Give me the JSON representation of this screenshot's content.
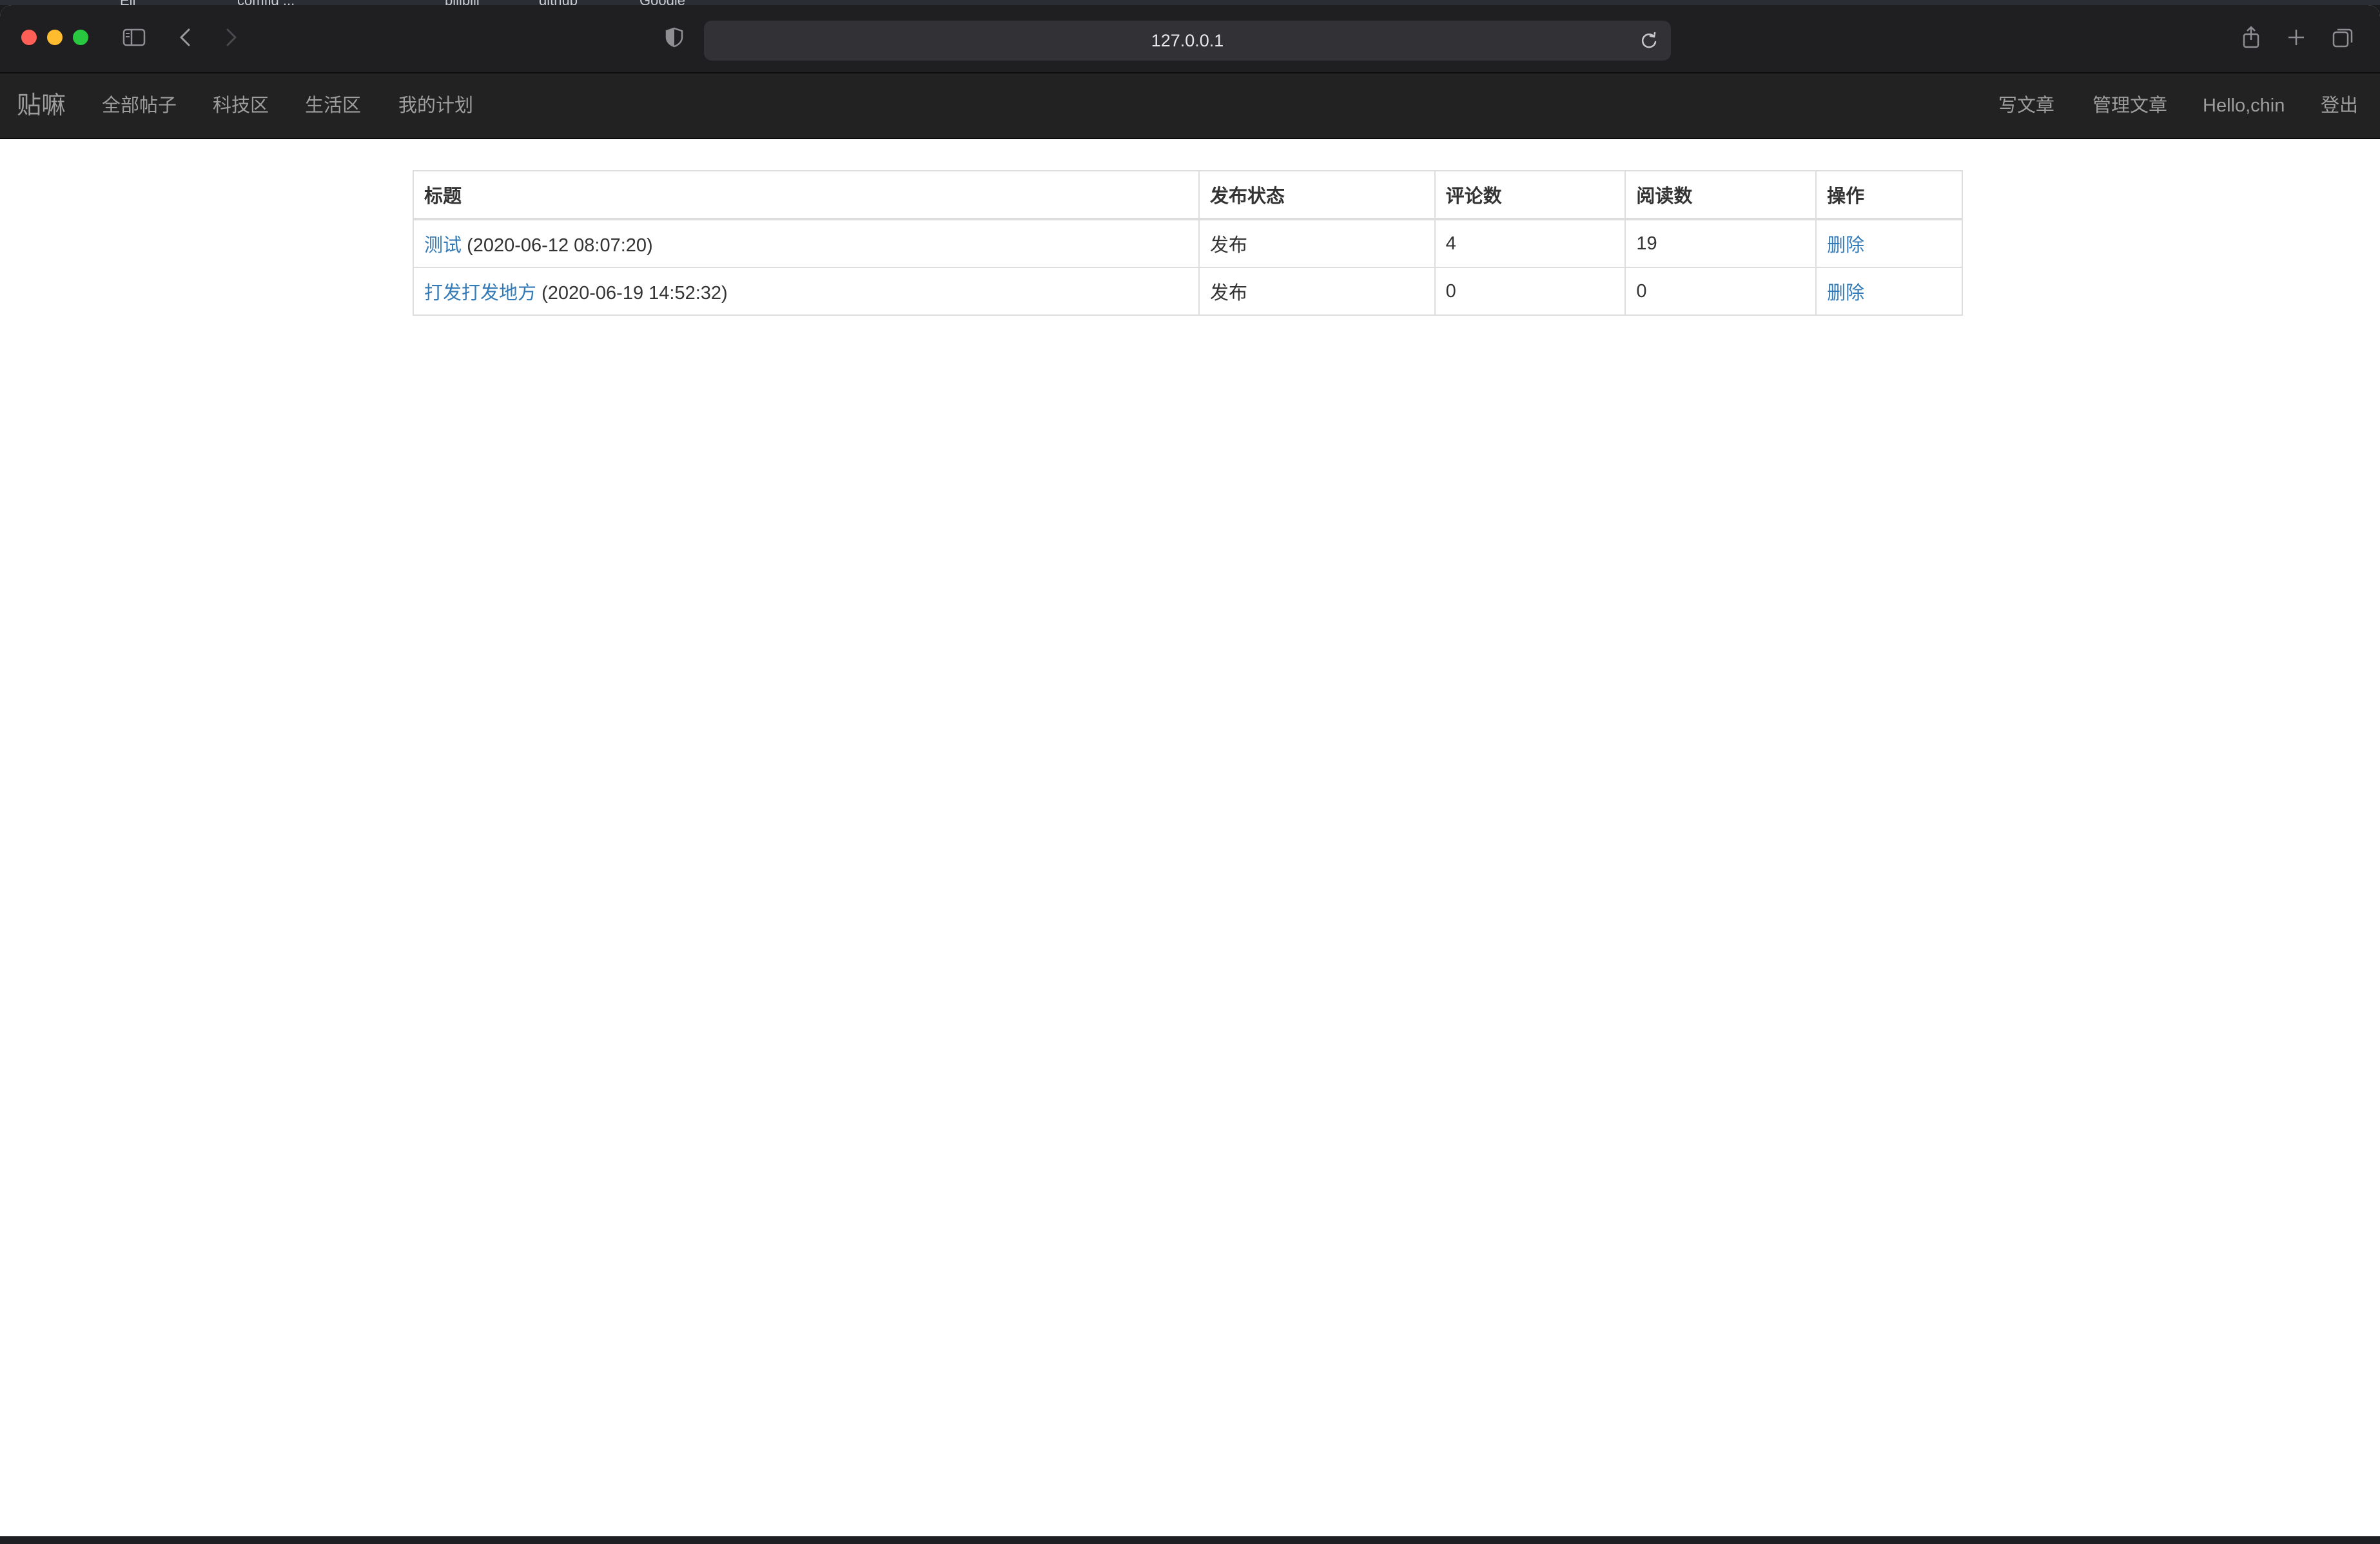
{
  "bookmarks": [
    "Ell",
    "comfig ...",
    "bilibili",
    "github",
    "Google"
  ],
  "browser": {
    "url": "127.0.0.1"
  },
  "navbar": {
    "brand": "贴嘛",
    "left_links": [
      "全部帖子",
      "科技区",
      "生活区",
      "我的计划"
    ],
    "right_links": [
      "写文章",
      "管理文章",
      "Hello,chin",
      "登出"
    ]
  },
  "table": {
    "headers": [
      "标题",
      "发布状态",
      "评论数",
      "阅读数",
      "操作"
    ],
    "rows": [
      {
        "title": "测试",
        "date": "(2020-06-12 08:07:20)",
        "status": "发布",
        "comments": "4",
        "reads": "19",
        "action": "删除"
      },
      {
        "title": "打发打发地方",
        "date": "(2020-06-19 14:52:32)",
        "status": "发布",
        "comments": "0",
        "reads": "0",
        "action": "删除"
      }
    ]
  },
  "colors": {
    "navbar_bg": "#222222",
    "nav_text": "#9d9d9d",
    "link": "#337ab7",
    "toolbar_bg": "#1f1f21"
  }
}
